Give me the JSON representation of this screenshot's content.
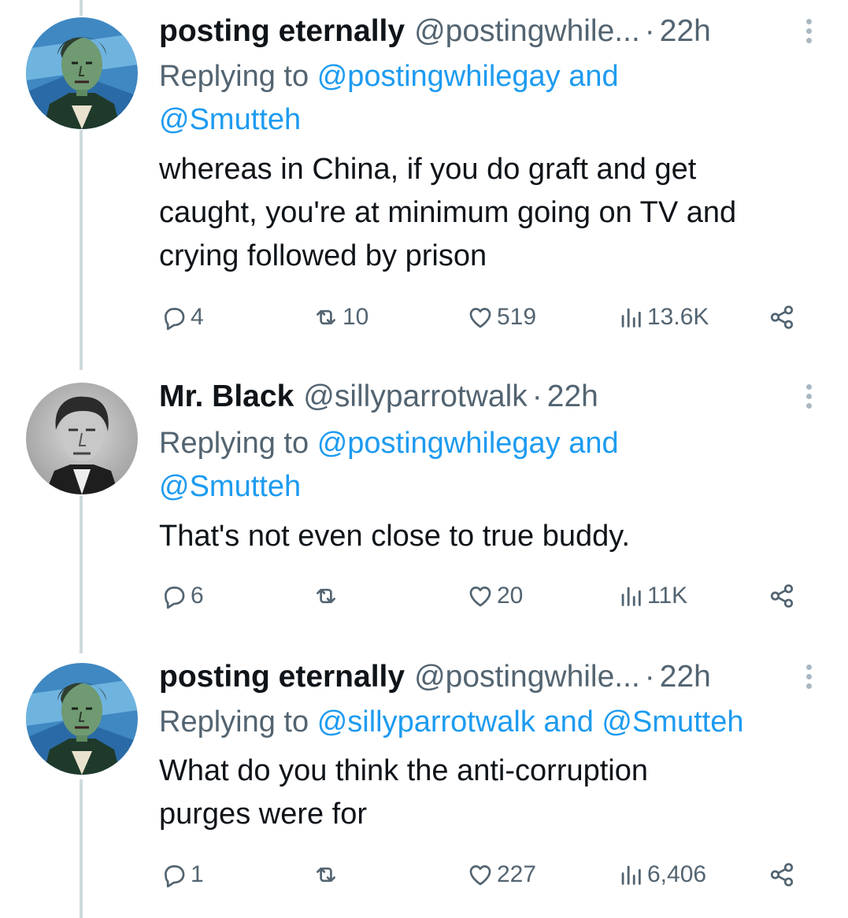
{
  "tweets": [
    {
      "name": "posting eternally",
      "handle": "@postingwhile...",
      "dot": "·",
      "time": "22h",
      "reply_prefix": "Replying to",
      "reply_line1": "@postingwhilegay and",
      "reply_line2": "@Smutteh",
      "body_lines": [
        "whereas in China, if you do graft and get",
        "caught, you're at minimum going on TV and",
        "crying followed by prison"
      ],
      "replies": "4",
      "retweets": "10",
      "likes": "519",
      "views": "13.6K"
    },
    {
      "name": "Mr. Black",
      "handle": "@sillyparrotwalk",
      "dot": "·",
      "time": "22h",
      "reply_prefix": "Replying to",
      "reply_line1": "@postingwhilegay and",
      "reply_line2": "@Smutteh",
      "body_lines": [
        "That's not even close to true buddy."
      ],
      "replies": "6",
      "retweets": "",
      "likes": "20",
      "views": "11K"
    },
    {
      "name": "posting eternally",
      "handle": "@postingwhile...",
      "dot": "·",
      "time": "22h",
      "reply_prefix": "Replying to",
      "reply_line1": "@sillyparrotwalk and @Smutteh",
      "body_lines": [
        "What do you think the anti-corruption",
        "purges were for"
      ],
      "replies": "1",
      "retweets": "",
      "likes": "227",
      "views": "6,406"
    }
  ],
  "icons": [
    "reply-icon",
    "retweet-icon",
    "like-icon",
    "views-icon",
    "share-icon",
    "more-icon"
  ],
  "colors": {
    "link": "#1d9bf0",
    "secondary": "#536471",
    "text": "#0f1419",
    "thread": "#cfd9de"
  }
}
